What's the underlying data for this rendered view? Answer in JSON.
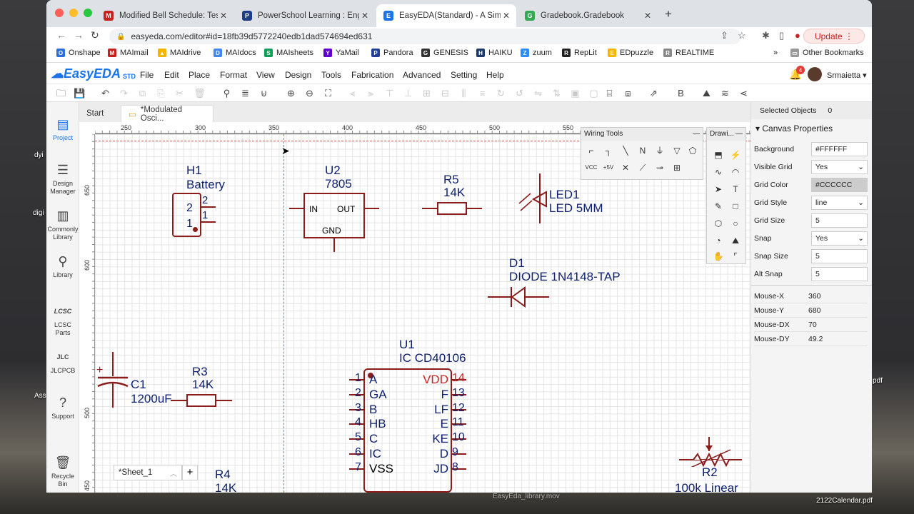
{
  "desktop": {
    "label1": "dyi",
    "label2": "digi",
    "label3": "Ass",
    "label4": "pdf",
    "file_mov": "EasyEda_library.mov",
    "file_pdf": "2122Calendar.pdf"
  },
  "browser": {
    "tabs": [
      "Modified Bell Schedule: Testing",
      "PowerSchool Learning : Engine",
      "EasyEDA(Standard) - A Simple",
      "Gradebook.Gradebook"
    ],
    "url": "easyeda.com/editor#id=18fb39d5772240edb1dad574694ed631",
    "update_label": "Update"
  },
  "bookmarks": [
    "Onshape",
    "MAImail",
    "MAIdrive",
    "MAIdocs",
    "MAIsheets",
    "YaMail",
    "Pandora",
    "GENESIS",
    "HAIKU",
    "zuum",
    "RepLit",
    "EDpuzzle",
    "REALTIME"
  ],
  "bookmarks_other": "Other Bookmarks",
  "app": {
    "brand": "EasyEDA",
    "edition": "STD",
    "menu": [
      "File",
      "Edit",
      "Place",
      "Format",
      "View",
      "Design",
      "Tools",
      "Fabrication",
      "Advanced",
      "Setting",
      "Help"
    ],
    "notifications": "4",
    "user": "Srmaietta"
  },
  "sidebar": [
    "Project",
    "Design Manager",
    "Commonly Library",
    "Library",
    "LCSC Parts",
    "JLCPCB",
    "Support",
    "Recycle Bin"
  ],
  "doc_tabs": [
    "Start",
    "*Modulated Osci..."
  ],
  "ruler": {
    "h": [
      "250",
      "300",
      "350",
      "400",
      "450",
      "500",
      "550"
    ],
    "v": [
      "650",
      "600",
      "500",
      "450"
    ]
  },
  "schematic": {
    "h1": {
      "ref": "H1",
      "value": "Battery",
      "pins": [
        "2",
        "1",
        "2",
        "1"
      ]
    },
    "u2": {
      "ref": "U2",
      "value": "7805",
      "pins": [
        "IN",
        "OUT",
        "GND"
      ]
    },
    "r5": {
      "ref": "R5",
      "value": "14K"
    },
    "led1": {
      "ref": "LED1",
      "value": "LED 5MM"
    },
    "d1": {
      "ref": "D1",
      "value": "DIODE 1N4148-TAP"
    },
    "u1": {
      "ref": "U1",
      "value": "IC CD40106",
      "left_pins": [
        {
          "num": "1",
          "name": "A"
        },
        {
          "num": "2",
          "name": "GA"
        },
        {
          "num": "3",
          "name": "B"
        },
        {
          "num": "4",
          "name": "HB"
        },
        {
          "num": "5",
          "name": "C"
        },
        {
          "num": "6",
          "name": "IC"
        },
        {
          "num": "7",
          "name": "VSS"
        }
      ],
      "right_pins": [
        {
          "num": "14",
          "name": "VDD"
        },
        {
          "num": "13",
          "name": "F"
        },
        {
          "num": "12",
          "name": "LF"
        },
        {
          "num": "11",
          "name": "E"
        },
        {
          "num": "10",
          "name": "KE"
        },
        {
          "num": "9",
          "name": "D"
        },
        {
          "num": "8",
          "name": "JD"
        }
      ]
    },
    "c1": {
      "ref": "C1",
      "value": "1200uF"
    },
    "r3": {
      "ref": "R3",
      "value": "14K"
    },
    "r4": {
      "ref": "R4",
      "value": "14K"
    },
    "r2": {
      "ref": "R2",
      "value": "100k Linear"
    }
  },
  "panels": {
    "wiring_title": "Wiring Tools",
    "drawing_title": "Drawi..."
  },
  "sheet": {
    "name": "*Sheet_1"
  },
  "properties": {
    "selected_label": "Selected Objects",
    "selected_count": "0",
    "section": "Canvas Properties",
    "rows": [
      {
        "k": "Background",
        "v": "#FFFFFF"
      },
      {
        "k": "Visible Grid",
        "v": "Yes"
      },
      {
        "k": "Grid Color",
        "v": "#CCCCCC"
      },
      {
        "k": "Grid Style",
        "v": "line"
      },
      {
        "k": "Grid Size",
        "v": "5"
      },
      {
        "k": "Snap",
        "v": "Yes"
      },
      {
        "k": "Snap Size",
        "v": "5"
      },
      {
        "k": "Alt Snap",
        "v": "5"
      }
    ],
    "mouse": [
      {
        "k": "Mouse-X",
        "v": "360"
      },
      {
        "k": "Mouse-Y",
        "v": "680"
      },
      {
        "k": "Mouse-DX",
        "v": "70"
      },
      {
        "k": "Mouse-DY",
        "v": "49.2"
      }
    ]
  }
}
